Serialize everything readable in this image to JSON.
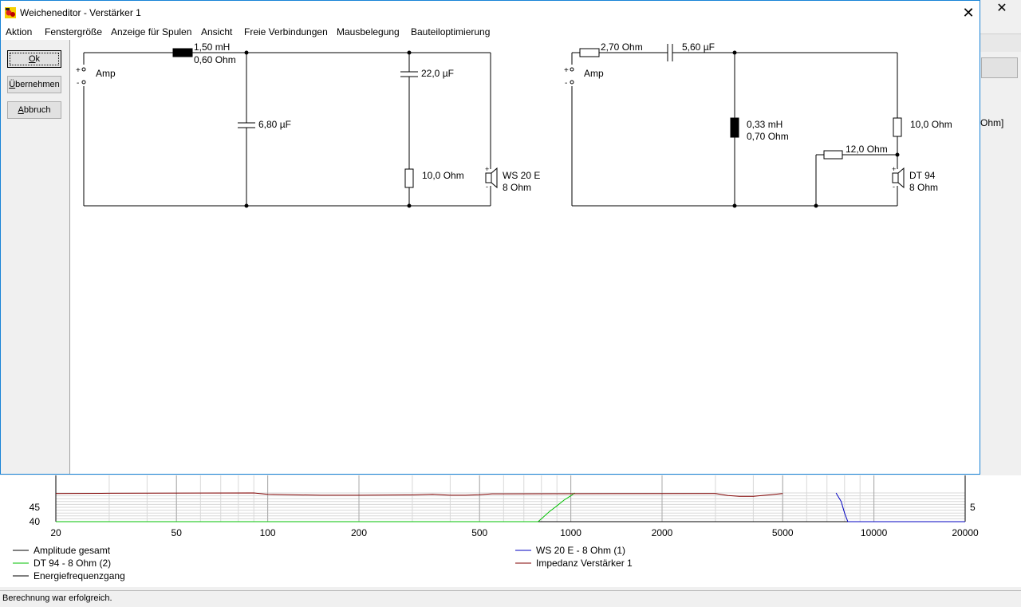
{
  "dialog": {
    "title": "Weicheneditor - Verstärker 1",
    "close_label": "✕"
  },
  "menu": {
    "items": [
      "Aktion",
      "Fenstergröße",
      "Anzeige für Spulen",
      "Ansicht",
      "Freie Verbindungen",
      "Mausbelegung",
      "Bauteiloptimierung"
    ]
  },
  "buttons": {
    "ok_mnemonic": "O",
    "ok_rest": "k",
    "apply_mnemonic": "Ü",
    "apply_rest": "bernehmen",
    "cancel_mnemonic": "A",
    "cancel_rest": "bbruch"
  },
  "circuit_left": {
    "amp_label": "Amp",
    "plus": "+",
    "minus": "-",
    "series_coil_value": "1,50 mH",
    "series_coil_res": "0,60 Ohm",
    "shunt_cap": "6,80 µF",
    "cap2": "22,0 µF",
    "resistor": "10,0 Ohm",
    "speaker_name": "WS 20 E",
    "speaker_imp": "8 Ohm"
  },
  "circuit_right": {
    "amp_label": "Amp",
    "plus": "+",
    "minus": "-",
    "series_res": "2,70 Ohm",
    "series_cap": "5,60 µF",
    "shunt_coil_value": "0,33 mH",
    "shunt_coil_res": "0,70 Ohm",
    "res_right": "10,0 Ohm",
    "res_mid": "12,0 Ohm",
    "speaker_name": "DT 94",
    "speaker_imp": "8 Ohm"
  },
  "background": {
    "close_label": "✕",
    "ohm_fragment": "Ohm]",
    "status": "Berechnung war erfolgreich."
  },
  "chart_data": {
    "type": "line",
    "x_ticks": [
      20,
      50,
      100,
      200,
      500,
      1000,
      2000,
      5000,
      10000,
      20000
    ],
    "y_ticks_left": [
      45,
      40
    ],
    "y_ticks_right": [
      5
    ],
    "xlim": [
      20,
      20000
    ],
    "ylim": [
      40,
      50
    ],
    "log_x": true,
    "grid": true,
    "series": [
      {
        "name": "Amplitude gesamt",
        "color": "#000000",
        "x": [],
        "y": []
      },
      {
        "name": "DT 94 - 8 Ohm (2)",
        "color": "#00c000",
        "x": [
          20,
          780,
          800,
          850,
          900,
          950,
          1000,
          1030
        ],
        "y": [
          40,
          40,
          41,
          43.5,
          45.5,
          47.5,
          49,
          50
        ]
      },
      {
        "name": "Energiefrequenzgang",
        "color": "#000000",
        "x": [],
        "y": []
      },
      {
        "name": "WS 20 E - 8 Ohm  (1)",
        "color": "#0000c0",
        "x": [
          7500,
          7800,
          8000,
          8200,
          20000
        ],
        "y": [
          50,
          47,
          43,
          40,
          40
        ]
      },
      {
        "name": "Impedanz Verstärker 1",
        "color": "#800000",
        "x": [
          20,
          30,
          90,
          100,
          150,
          200,
          300,
          350,
          400,
          450,
          500,
          550,
          3000,
          3300,
          3600,
          4000,
          4500,
          5000
        ],
        "y": [
          49.8,
          49.9,
          50,
          49.5,
          49.2,
          49.2,
          49.3,
          49.5,
          49.2,
          49.2,
          49.4,
          49.7,
          49.8,
          49.1,
          48.8,
          48.8,
          49.3,
          49.8
        ]
      }
    ]
  }
}
